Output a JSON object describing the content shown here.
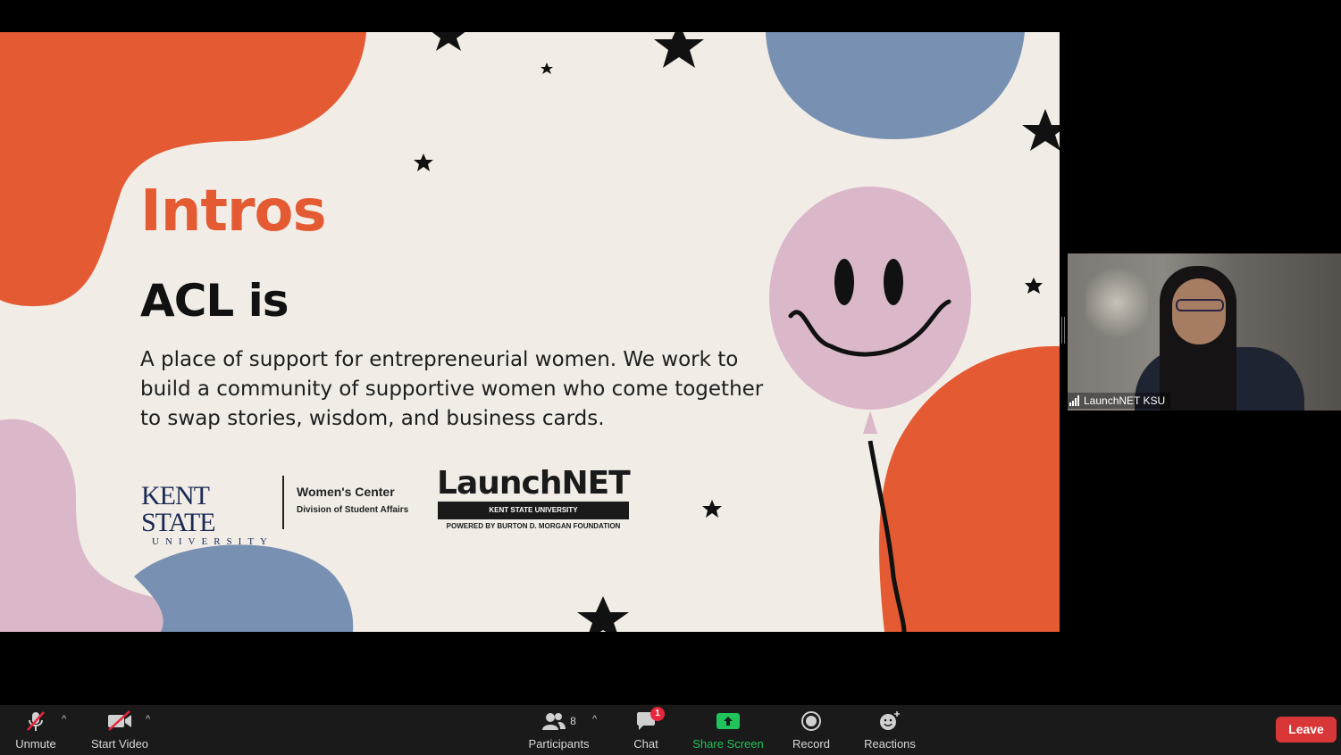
{
  "slide": {
    "title": "Intros",
    "subtitle": "ACL is",
    "body": "A place of support for entrepreneurial women. We work to build a community of supportive women who come together to swap stories, wisdom, and business cards.",
    "logos": {
      "ksu_name": "KENT STATE",
      "ksu_university": "UNIVERSITY",
      "womens_center": "Women's Center",
      "division": "Division of Student Affairs",
      "launchnet": "LaunchNET",
      "launchnet_bar": "KENT STATE UNIVERSITY",
      "launchnet_powered": "POWERED BY BURTON D. MORGAN FOUNDATION"
    },
    "colors": {
      "orange": "#e35a33",
      "blue": "#7890b2",
      "pink": "#dbb8c9",
      "cream": "#f1ede6"
    }
  },
  "participant": {
    "name": "LaunchNET KSU",
    "icon": "signal-bars-icon"
  },
  "toolbar": {
    "unmute": {
      "label": "Unmute",
      "icon": "microphone-muted-icon"
    },
    "start_video": {
      "label": "Start Video",
      "icon": "video-off-icon"
    },
    "participants": {
      "label": "Participants",
      "count": "8",
      "icon": "participants-icon"
    },
    "chat": {
      "label": "Chat",
      "badge": "1",
      "icon": "chat-icon"
    },
    "share_screen": {
      "label": "Share Screen",
      "icon": "share-screen-icon"
    },
    "record": {
      "label": "Record",
      "icon": "record-icon"
    },
    "reactions": {
      "label": "Reactions",
      "icon": "reactions-icon"
    },
    "leave": {
      "label": "Leave"
    },
    "colors": {
      "share": "#21c35b",
      "leave": "#d93737",
      "badge": "#e8263b"
    }
  }
}
